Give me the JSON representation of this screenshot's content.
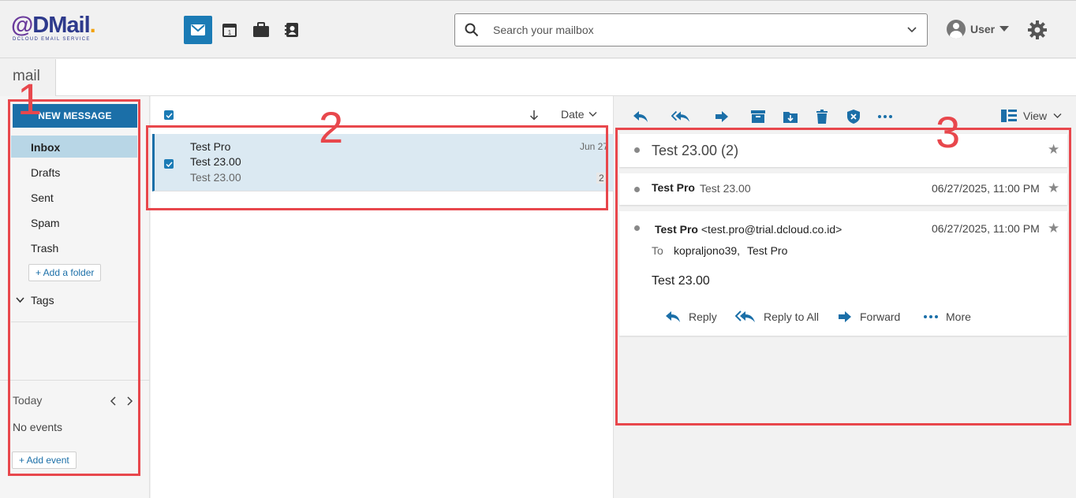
{
  "logo": {
    "at": "@",
    "name": "DMail",
    "dot": ".",
    "subtitle": "DCLOUD EMAIL SERVICE"
  },
  "apps": [
    "mail-icon",
    "calendar-icon",
    "briefcase-icon",
    "contacts-icon"
  ],
  "search": {
    "placeholder": "Search your mailbox"
  },
  "user": {
    "label": "User"
  },
  "tab": {
    "label": "mail"
  },
  "sidebar": {
    "new_message": "NEW MESSAGE",
    "folders": [
      {
        "label": "Inbox",
        "active": true
      },
      {
        "label": "Drafts"
      },
      {
        "label": "Sent"
      },
      {
        "label": "Spam"
      },
      {
        "label": "Trash"
      }
    ],
    "add_folder": "+ Add a folder",
    "tags": "Tags",
    "calendar": {
      "today": "Today",
      "no_events": "No events",
      "add_event": "+ Add event"
    }
  },
  "list": {
    "sort_label": "Date",
    "rows": [
      {
        "from": "Test Pro",
        "subject": "Test 23.00",
        "preview": "Test 23.00",
        "date": "Jun 27",
        "count": "2"
      }
    ]
  },
  "reader": {
    "view_label": "View",
    "thread_title": "Test 23.00 (2)",
    "messages": [
      {
        "from": "Test Pro",
        "subject": "Test 23.00",
        "datetime": "06/27/2025, 11:00 PM"
      },
      {
        "from": "Test Pro",
        "email": "<test.pro@trial.dcloud.co.id>",
        "datetime": "06/27/2025, 11:00 PM",
        "to_label": "To",
        "to_1": "kopraljono39,",
        "to_2": "Test Pro",
        "body": "Test 23.00"
      }
    ],
    "actions": {
      "reply": "Reply",
      "reply_all": "Reply to All",
      "forward": "Forward",
      "more": "More"
    }
  },
  "annotations": {
    "n1": "1",
    "n2": "2",
    "n3": "3"
  },
  "colors": {
    "accent": "#1b6fa8",
    "annotation": "#e8474c",
    "selected_row": "#dbe9f2"
  }
}
